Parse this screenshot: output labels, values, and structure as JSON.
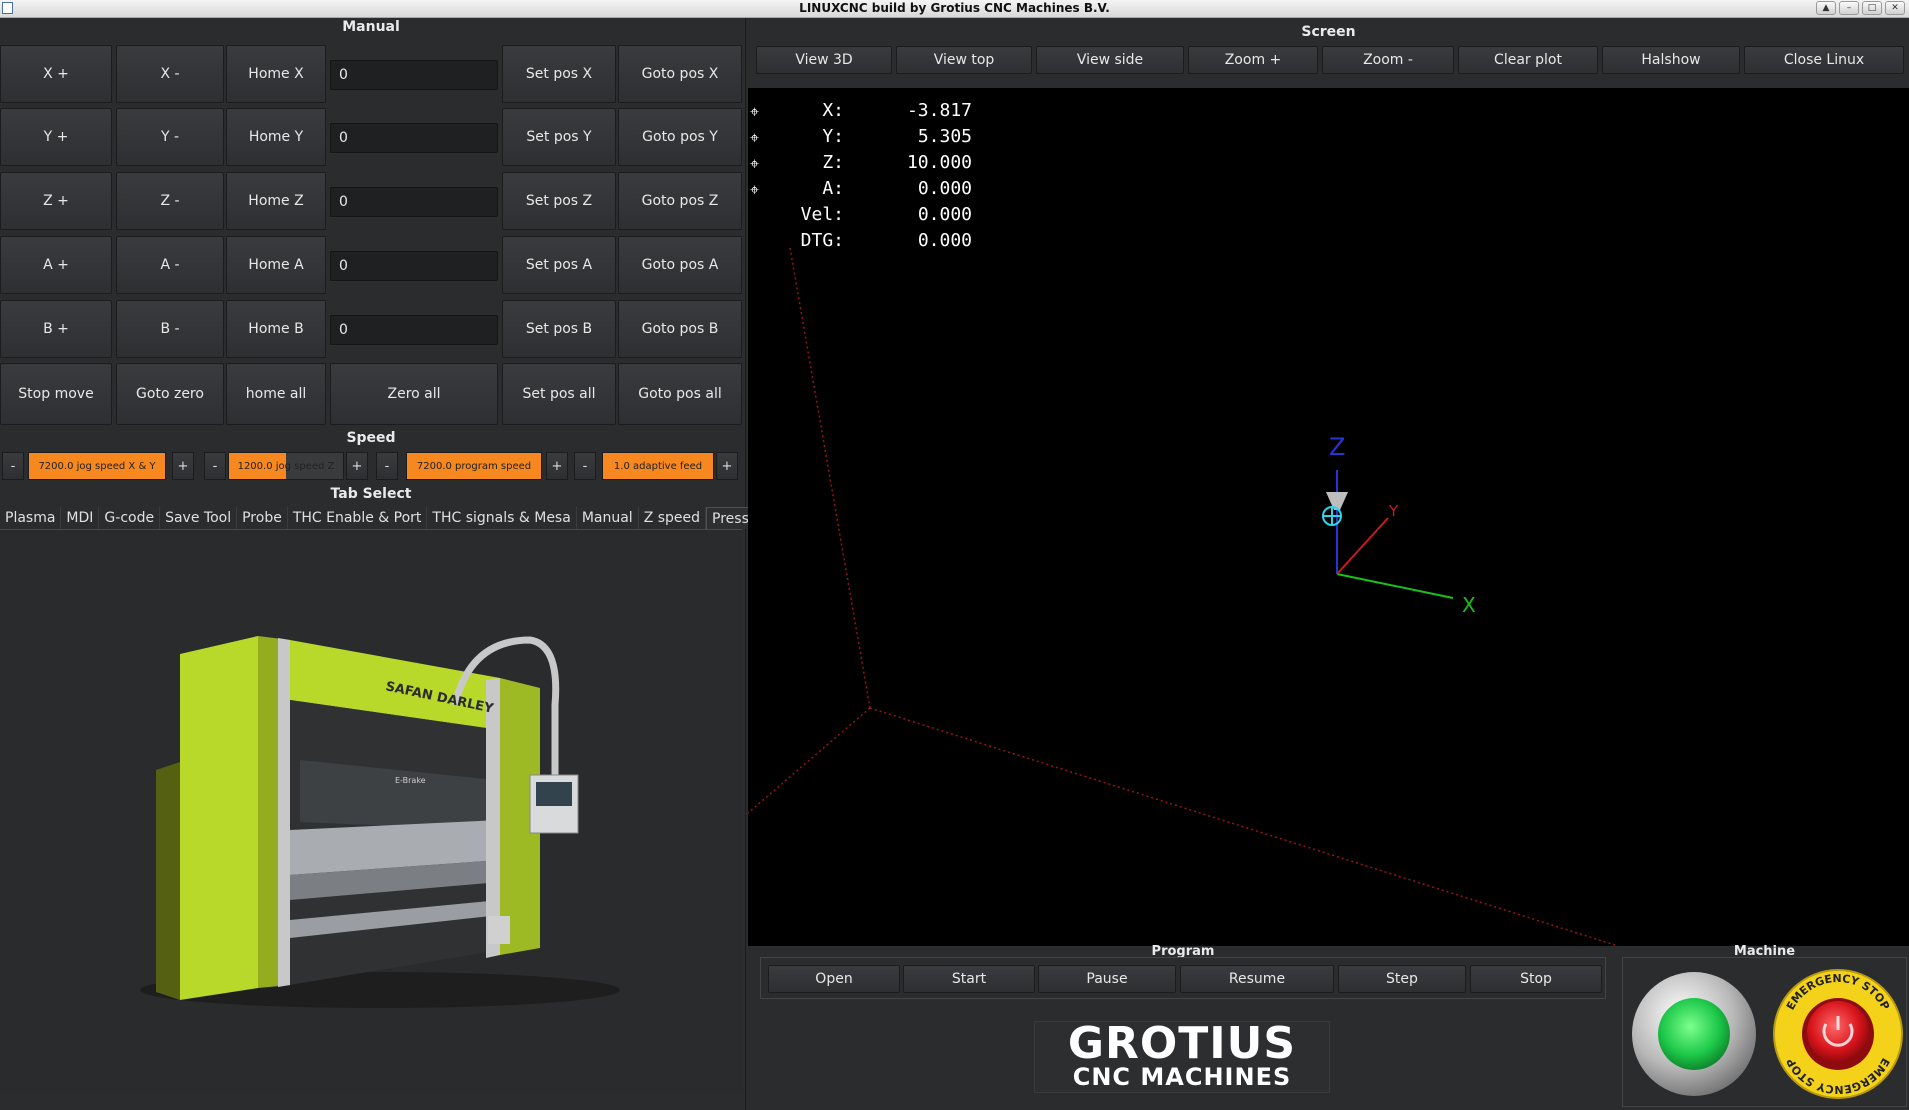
{
  "window": {
    "title": "LINUXCNC build by Grotius CNC Machines B.V."
  },
  "manual": {
    "title": "Manual",
    "rows": [
      {
        "plus": "X +",
        "minus": "X -",
        "home": "Home X",
        "value": "0",
        "setpos": "Set pos X",
        "gotopos": "Goto pos X"
      },
      {
        "plus": "Y +",
        "minus": "Y -",
        "home": "Home Y",
        "value": "0",
        "setpos": "Set pos Y",
        "gotopos": "Goto pos Y"
      },
      {
        "plus": "Z +",
        "minus": "Z -",
        "home": "Home Z",
        "value": "0",
        "setpos": "Set pos Z",
        "gotopos": "Goto pos Z"
      },
      {
        "plus": "A +",
        "minus": "A -",
        "home": "Home A",
        "value": "0",
        "setpos": "Set pos A",
        "gotopos": "Goto pos A"
      },
      {
        "plus": "B +",
        "minus": "B -",
        "home": "Home B",
        "value": "0",
        "setpos": "Set pos B",
        "gotopos": "Goto pos B"
      }
    ],
    "bottom": {
      "stop_move": "Stop move",
      "goto_zero": "Goto zero",
      "home_all": "home all",
      "zero_all": "Zero all",
      "set_pos_all": "Set pos all",
      "goto_pos_all": "Goto pos all"
    }
  },
  "speed": {
    "title": "Speed",
    "minus": "-",
    "plus": "+",
    "bars": [
      {
        "label": "7200.0 jog speed X & Y",
        "fill_fraction": 1.0
      },
      {
        "label": "1200.0 jog speed Z",
        "fill_fraction": 0.5
      },
      {
        "label": "7200.0 program speed",
        "fill_fraction": 1.0
      },
      {
        "label": "1.0 adaptive feed",
        "fill_fraction": 1.0
      }
    ]
  },
  "tab_select": {
    "title": "Tab Select",
    "tabs": [
      "Plasma",
      "MDI",
      "G-code",
      "Save Tool",
      "Probe",
      "THC Enable & Port",
      "THC signals & Mesa",
      "Manual",
      "Z speed",
      "Press brake"
    ],
    "active": "Press brake"
  },
  "press_brake": {
    "brand": "SAFAN DARLEY",
    "model": "E-Brake"
  },
  "screen": {
    "title": "Screen",
    "buttons": [
      "View 3D",
      "View top",
      "View side",
      "Zoom +",
      "Zoom -",
      "Clear plot",
      "Halshow",
      "Close Linux"
    ]
  },
  "dro": [
    {
      "label": "X:",
      "value": "-3.817"
    },
    {
      "label": "Y:",
      "value": "5.305"
    },
    {
      "label": "Z:",
      "value": "10.000"
    },
    {
      "label": "A:",
      "value": "0.000"
    },
    {
      "label": "Vel:",
      "value": "0.000"
    },
    {
      "label": "DTG:",
      "value": "0.000"
    }
  ],
  "axes": {
    "x": "X",
    "y": "Y",
    "z": "Z"
  },
  "program": {
    "title": "Program",
    "buttons": [
      "Open",
      "Start",
      "Pause",
      "Resume",
      "Step",
      "Stop"
    ]
  },
  "machine": {
    "title": "Machine",
    "estop_text_top": "EMERGENCY STOP",
    "estop_text_bottom": "EMERGENCY STOP"
  },
  "logo": {
    "line1": "GROTIUS",
    "line2": "CNC MACHINES"
  },
  "colors": {
    "accent": "#f7871f",
    "background": "#2b2c2e",
    "viewport": "#000000",
    "green": "#1ec94a",
    "red": "#d8141b",
    "yellow": "#f5d21a"
  }
}
